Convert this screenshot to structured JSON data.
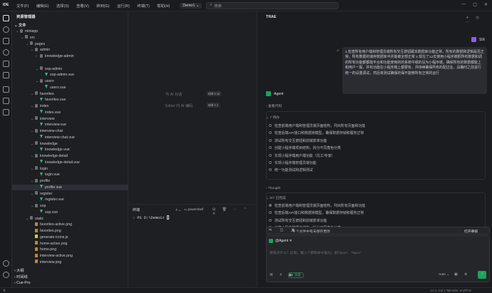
{
  "titlebar": {
    "logo": "IDE",
    "menu": [
      "文件(F)",
      "编辑(E)",
      "选择(S)",
      "查看(V)",
      "转到(G)",
      "运行(R)",
      "终端(T)",
      "帮助(H)"
    ],
    "project": "Demo1 ⌄",
    "search_placeholder": "搜索",
    "win_controls": [
      "—",
      "▢",
      "✕"
    ]
  },
  "explorer": {
    "title": "资源管理器",
    "section_files": "文件",
    "section_outline": "大纲",
    "section_timeline": "时间线",
    "section_cue": "Cue-Pro",
    "tree": [
      {
        "label": "miniapp",
        "depth": 0,
        "type": "folder",
        "open": true
      },
      {
        "label": "src",
        "depth": 1,
        "type": "folder",
        "open": true
      },
      {
        "label": "pages",
        "depth": 2,
        "type": "folder",
        "open": true
      },
      {
        "label": "admin",
        "depth": 3,
        "type": "folder",
        "open": true
      },
      {
        "label": "knowledge-admin",
        "depth": 4,
        "type": "folder",
        "open": false
      },
      {
        "label": "",
        "depth": 5,
        "type": "spacer"
      },
      {
        "label": "sop-admin",
        "depth": 4,
        "type": "folder",
        "open": true
      },
      {
        "label": "sop-admin.vue",
        "depth": 5,
        "type": "vue"
      },
      {
        "label": "users",
        "depth": 4,
        "type": "folder",
        "open": true
      },
      {
        "label": "users.vue",
        "depth": 5,
        "type": "vue"
      },
      {
        "label": "favorites",
        "depth": 3,
        "type": "folder",
        "open": true
      },
      {
        "label": "favorites.vue",
        "depth": 4,
        "type": "vue"
      },
      {
        "label": "index",
        "depth": 3,
        "type": "folder",
        "open": true
      },
      {
        "label": "index.vue",
        "depth": 4,
        "type": "vue"
      },
      {
        "label": "interview",
        "depth": 3,
        "type": "folder",
        "open": true
      },
      {
        "label": "interview.vue",
        "depth": 4,
        "type": "vue"
      },
      {
        "label": "interview-chat",
        "depth": 3,
        "type": "folder",
        "open": true
      },
      {
        "label": "interview-chat.vue",
        "depth": 4,
        "type": "vue"
      },
      {
        "label": "knowledge",
        "depth": 3,
        "type": "folder",
        "open": true
      },
      {
        "label": "knowledge.vue",
        "depth": 4,
        "type": "vue"
      },
      {
        "label": "knowledge-detail",
        "depth": 3,
        "type": "folder",
        "open": true
      },
      {
        "label": "knowledge-detail.vue",
        "depth": 4,
        "type": "vue"
      },
      {
        "label": "login",
        "depth": 3,
        "type": "folder",
        "open": true
      },
      {
        "label": "login.vue",
        "depth": 4,
        "type": "vue"
      },
      {
        "label": "profile",
        "depth": 3,
        "type": "folder",
        "open": true
      },
      {
        "label": "profile.vue",
        "depth": 4,
        "type": "vue",
        "selected": true
      },
      {
        "label": "register",
        "depth": 3,
        "type": "folder",
        "open": true
      },
      {
        "label": "register.vue",
        "depth": 4,
        "type": "vue"
      },
      {
        "label": "sop",
        "depth": 3,
        "type": "folder",
        "open": true
      },
      {
        "label": "sop.vue",
        "depth": 4,
        "type": "vue"
      },
      {
        "label": "static",
        "depth": 2,
        "type": "folder",
        "open": true
      },
      {
        "label": "favorites-active.png",
        "depth": 3,
        "type": "png"
      },
      {
        "label": "favorites.png",
        "depth": 3,
        "type": "png"
      },
      {
        "label": "generate-icons.js",
        "depth": 3,
        "type": "js"
      },
      {
        "label": "home-active.png",
        "depth": 3,
        "type": "png"
      },
      {
        "label": "home.png",
        "depth": 3,
        "type": "png"
      },
      {
        "label": "interview-active.png",
        "depth": 3,
        "type": "png"
      },
      {
        "label": "interview.png",
        "depth": 3,
        "type": "png"
      }
    ]
  },
  "editor": {
    "hints": [
      {
        "label": "与 AI 对话",
        "keys": [
          "Ctrl",
          "+",
          "U"
        ]
      },
      {
        "label": "Editor 内 AI 编码",
        "keys": [
          "Ctrl",
          "+",
          "I"
        ]
      }
    ]
  },
  "terminal": {
    "tab": "终端",
    "shell": "powershell",
    "prompt": "PS D:\\Demo1> "
  },
  "ai": {
    "header": "TRAE",
    "user": "SIX",
    "message": "1.检查所有用户端和管理员端所有交互按钮跟本数据库功能正常，所有的数据和逻辑是否正常，所有数据的储存数据库中并能被全部正常\n2.现在了12支使用小程序端把所有数据和调的所有功能都都能平台和功能使用的的系统中组的没为小程序端，确保所有的数据都能上和用户一股，并有功能在小程序端上都要有，并持续确保所有的配过业，具确时之前进行统一的设置调试，然后将测试确保的保不能够所有正常的运行",
    "agent": "Agent",
    "reviewed": "查看代码",
    "todo_title": "7 待办",
    "todos": [
      "检查前端用户端和管理员端页面结构，列出所有页面和功能",
      "检查后端API接口和数据库模型，确保数据存储和服务正常",
      "测试所有交互按钮和前端表单功能",
      "创建小程序端项目结构，拆分不同角色分类",
      "实现小程序端用户端功能（员工/专家）",
      "实现小程序端管理员端功能",
      "统一功能测试和逻辑测试"
    ],
    "thought": "Thought",
    "done_title": "0/7 已完成",
    "todos2": [
      "检查前端用户端和管理员端页面结构，列出所有页面和功能",
      "检查后端API接口和数据库模型，确保数据存储和服务正常",
      "测试所有交互按钮和前端表单功能",
      "创建小程序端项目结构，拆分不同角色分类"
    ],
    "changes": "8 个文件中有未保存更改",
    "open_review": "打开审核",
    "mention": "@Agent ✕",
    "input_placeholder": "想说点什么？比如，输入“/”获取命令能力；如“/plan”、“/spec”",
    "thinking": "深度",
    "mode": "Auto ⌄"
  },
  "status": {
    "left": "⊗ 0  ⚠ 0",
    "right": "Ln 1, Col 1   Tab Size: 4   UTF-8"
  }
}
